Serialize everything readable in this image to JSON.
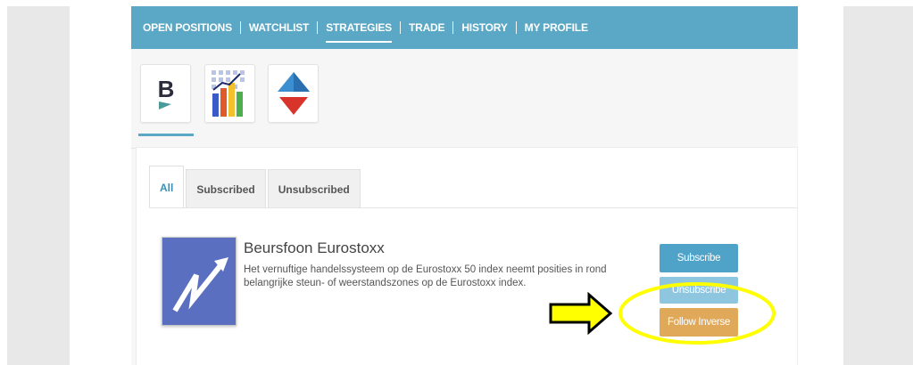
{
  "nav": {
    "items": [
      {
        "label": "OPEN POSITIONS",
        "active": false
      },
      {
        "label": "WATCHLIST",
        "active": false
      },
      {
        "label": "STRATEGIES",
        "active": true
      },
      {
        "label": "TRADE",
        "active": false
      },
      {
        "label": "HISTORY",
        "active": false
      },
      {
        "label": "MY PROFILE",
        "active": false
      }
    ]
  },
  "strategy_icons": [
    {
      "icon": "beursfoon-b-logo-icon",
      "text": "B"
    },
    {
      "icon": "bar-chart-grid-icon"
    },
    {
      "icon": "up-down-arrows-icon"
    }
  ],
  "tabs": [
    {
      "label": "All",
      "active": true
    },
    {
      "label": "Subscribed",
      "active": false
    },
    {
      "label": "Unsubscribed",
      "active": false
    }
  ],
  "strategy": {
    "title": "Beursfoon Eurostoxx",
    "description": "Het vernuftige handelssysteem op de Eurostoxx 50 index neemt posities in rond belangrijke steun- of weerstandszones op de Eurostoxx index.",
    "subscribe_label": "Subscribe",
    "unsubscribe_label": "Unsubscribe",
    "follow_inverse_label": "Follow Inverse"
  },
  "colors": {
    "nav_bg": "#5aa7c6",
    "subscribe": "#4fa3c9",
    "unsubscribe": "#8ec6e0",
    "follow_inverse": "#e0a95a",
    "logo_bg": "#5b6fc0",
    "annotation": "#ffff00"
  }
}
